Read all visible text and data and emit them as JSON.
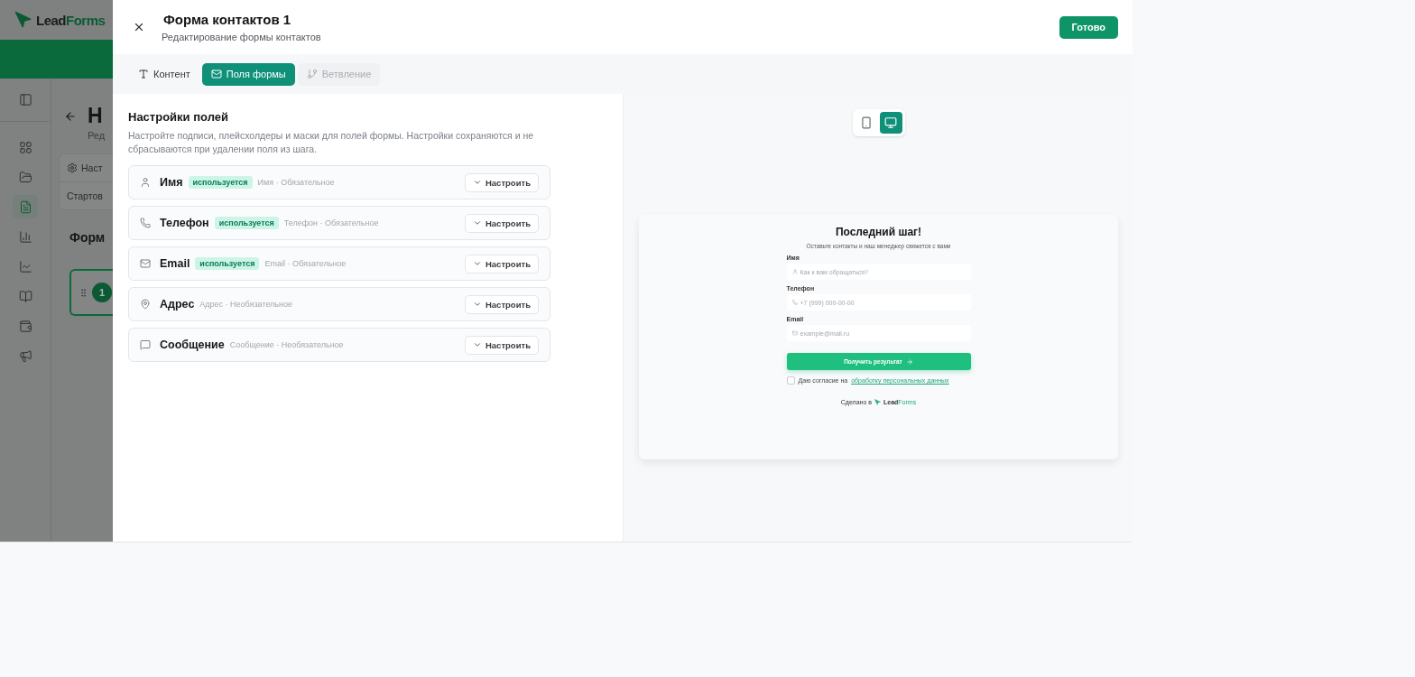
{
  "background_app": {
    "logo": {
      "lead": "Lead",
      "forms": "Forms"
    },
    "nav_items": [
      {
        "selected": false
      },
      {
        "selected": false
      },
      {
        "selected": false
      },
      {
        "selected": true
      },
      {
        "selected": false
      },
      {
        "selected": false
      },
      {
        "selected": false
      },
      {
        "selected": false
      },
      {
        "selected": false
      }
    ],
    "page_title": "Н",
    "page_subtitle": "Ред",
    "settings_tab": "Наст",
    "start_label": "Стартов",
    "forms_heading": "Форм",
    "step_number": "1"
  },
  "dialog": {
    "title": "Форма контактов 1",
    "subtitle": "Редактирование формы контактов",
    "done_button": "Готово"
  },
  "tabs": [
    {
      "label": "Контент",
      "selected": false,
      "disabled": false
    },
    {
      "label": "Поля формы",
      "selected": true,
      "disabled": false
    },
    {
      "label": "Ветвление",
      "selected": false,
      "disabled": true
    }
  ],
  "fields_section": {
    "title": "Настройки полей",
    "description": "Настройте подписи, плейсхолдеры и маски для полей формы. Настройки сохраняются и не сбрасываются при удалении поля из шага.",
    "fields": [
      {
        "name": "Имя",
        "badge": "используется",
        "meta": "Имя · Обязательное",
        "button": "Настроить"
      },
      {
        "name": "Телефон",
        "badge": "используется",
        "meta": "Телефон · Обязательное",
        "button": "Настроить"
      },
      {
        "name": "Email",
        "badge": "используется",
        "meta": "Email · Обязательное",
        "button": "Настроить"
      },
      {
        "name": "Адрес",
        "meta": "Адрес · Необязательное",
        "button": "Настроить"
      },
      {
        "name": "Сообщение",
        "meta": "Сообщение · Необязательное",
        "button": "Настроить"
      }
    ]
  },
  "preview": {
    "devices": [
      {
        "kind": "mobile",
        "selected": false
      },
      {
        "kind": "desktop",
        "selected": true
      }
    ],
    "form": {
      "title": "Последний шаг!",
      "subtitle": "Оставьте контакты и наш менеджер свяжется с вами",
      "inputs": [
        {
          "label": "Имя",
          "placeholder": "Как к вам обращаться?"
        },
        {
          "label": "Телефон",
          "placeholder": "+7 (999) 000-00-00"
        },
        {
          "label": "Email",
          "placeholder": "example@mail.ru"
        }
      ],
      "submit": "Получить результат",
      "consent": {
        "checked": false,
        "text": "Даю согласие на",
        "link": "обработку персональных данных"
      },
      "footer": {
        "made_in": "Сделано в",
        "lead": "Lead",
        "forms": "Forms"
      }
    }
  }
}
